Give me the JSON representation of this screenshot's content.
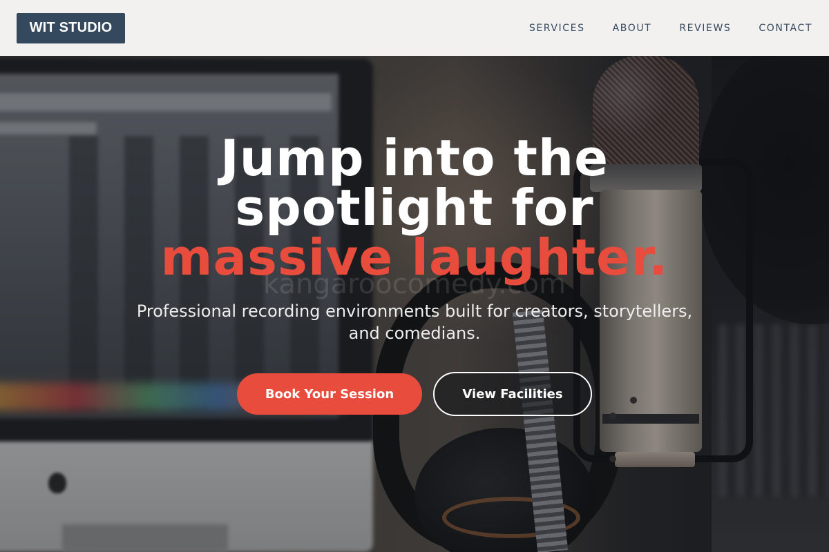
{
  "header": {
    "logo_text": "WIT STUDIO",
    "nav": [
      {
        "label": "SERVICES"
      },
      {
        "label": "ABOUT"
      },
      {
        "label": "REVIEWS"
      },
      {
        "label": "CONTACT"
      }
    ]
  },
  "hero": {
    "headline_line1": "Jump into the",
    "headline_line2": "spotlight for",
    "headline_accent": "massive laughter.",
    "watermark": "kangaroocomedy.com",
    "subtext": "Professional recording environments built for creators, storytellers, and comedians.",
    "primary_cta": "Book Your Session",
    "secondary_cta": "View Facilities"
  },
  "colors": {
    "accent": "#e74c3c",
    "brand_dark": "#34495e",
    "header_bg": "#f2f1f0"
  }
}
